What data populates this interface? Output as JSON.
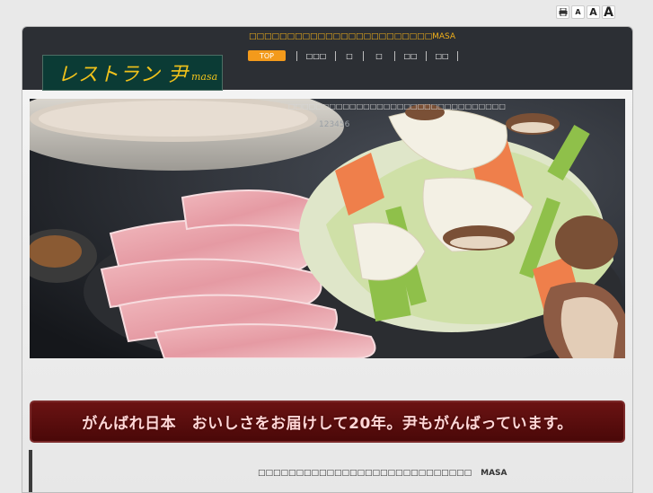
{
  "utility": {
    "print_icon": "printer-icon",
    "font_small": "A",
    "font_medium": "A",
    "font_large": "A"
  },
  "header": {
    "site_title": "□□□□□□□□□□□□□□□□□□□□□□□□MASA",
    "logo_jp": "レストラン 尹",
    "logo_en": "masa"
  },
  "nav": {
    "items": [
      {
        "label": "TOP",
        "active": true
      },
      {
        "label": "□□□"
      },
      {
        "label": "□"
      },
      {
        "label": "□"
      },
      {
        "label": "□□"
      },
      {
        "label": "□□"
      }
    ]
  },
  "hero": {
    "caption": "□□□□□□□□□□□□□□□□□□□□□□□□□□□□□□□□",
    "number": "123456"
  },
  "banner": {
    "text": "がんばれ日本　おいしさをお届けして20年。尹もがんばっています。"
  },
  "content": {
    "text": "□□□□□□□□□□□□□□□□□□□□□□□□□□□□",
    "masa": "MASA"
  },
  "colors": {
    "header_bg": "#2c2f34",
    "accent": "#f39a1b",
    "title": "#f2b11a",
    "banner_bg": "#5a0e0e"
  }
}
